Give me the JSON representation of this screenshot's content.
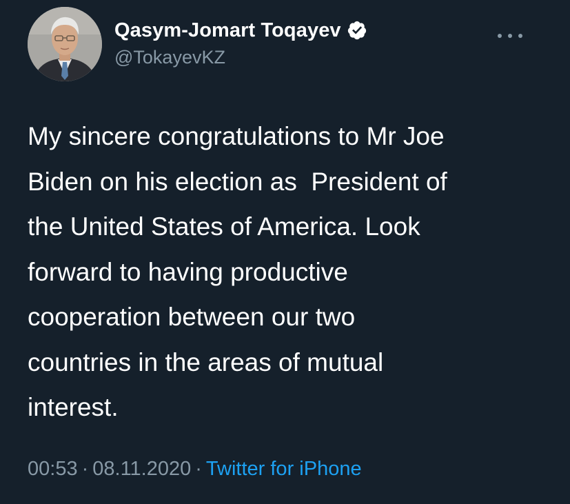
{
  "author": {
    "display_name": "Qasym-Jomart Toqayev",
    "handle": "@TokayevKZ",
    "verified": true,
    "verified_icon": "verified-badge-icon",
    "avatar": "profile-photo"
  },
  "menu": {
    "icon": "more-options-icon"
  },
  "tweet": {
    "lines": [
      "My sincere congratulations to Mr Joe",
      "Biden on his election as  President of",
      "the United States of America. Look",
      "forward to having productive",
      "cooperation between our two",
      "countries in the areas of mutual",
      "interest."
    ]
  },
  "meta": {
    "time": "00:53",
    "separator": "·",
    "date": "08.11.2020",
    "source": "Twitter for iPhone"
  },
  "colors": {
    "background": "#15202b",
    "text": "#ffffff",
    "muted": "#8899a6",
    "accent": "#1da1f2"
  }
}
